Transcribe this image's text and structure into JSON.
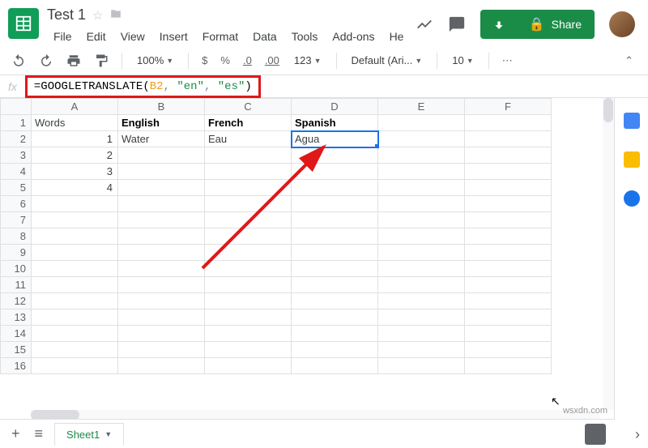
{
  "doc": {
    "title": "Test 1"
  },
  "menu": {
    "file": "File",
    "edit": "Edit",
    "view": "View",
    "insert": "Insert",
    "format": "Format",
    "data": "Data",
    "tools": "Tools",
    "addons": "Add-ons",
    "help": "He"
  },
  "share": {
    "label": "Share"
  },
  "toolbar": {
    "zoom": "100%",
    "font": "Default (Ari...",
    "fontsize": "10",
    "decimal_inc": ".0",
    "decimal_dec": ".00",
    "format_num": "123",
    "currency": "$",
    "percent": "%",
    "more": "⋯"
  },
  "formula": {
    "fx": "fx",
    "eq": "=",
    "fn": "GOOGLETRANSLATE",
    "ref": "B2",
    "str1": "\"en\"",
    "str2": "\"es\"",
    "open": "(",
    "close": ")",
    "comma": ", "
  },
  "columns": [
    "A",
    "B",
    "C",
    "D",
    "E",
    "F"
  ],
  "rows": [
    "1",
    "2",
    "3",
    "4",
    "5",
    "6",
    "7",
    "8",
    "9",
    "10",
    "11",
    "12",
    "13",
    "14",
    "15",
    "16"
  ],
  "cells": {
    "A1": "Words",
    "B1": "English",
    "C1": "French",
    "D1": "Spanish",
    "A2": "1",
    "B2": "Water",
    "C2": "Eau",
    "D2": "Agua",
    "A3": "2",
    "A4": "3",
    "A5": "4"
  },
  "tabs": {
    "sheet1": "Sheet1"
  },
  "watermark": "wsxdn.com",
  "chart_data": null
}
